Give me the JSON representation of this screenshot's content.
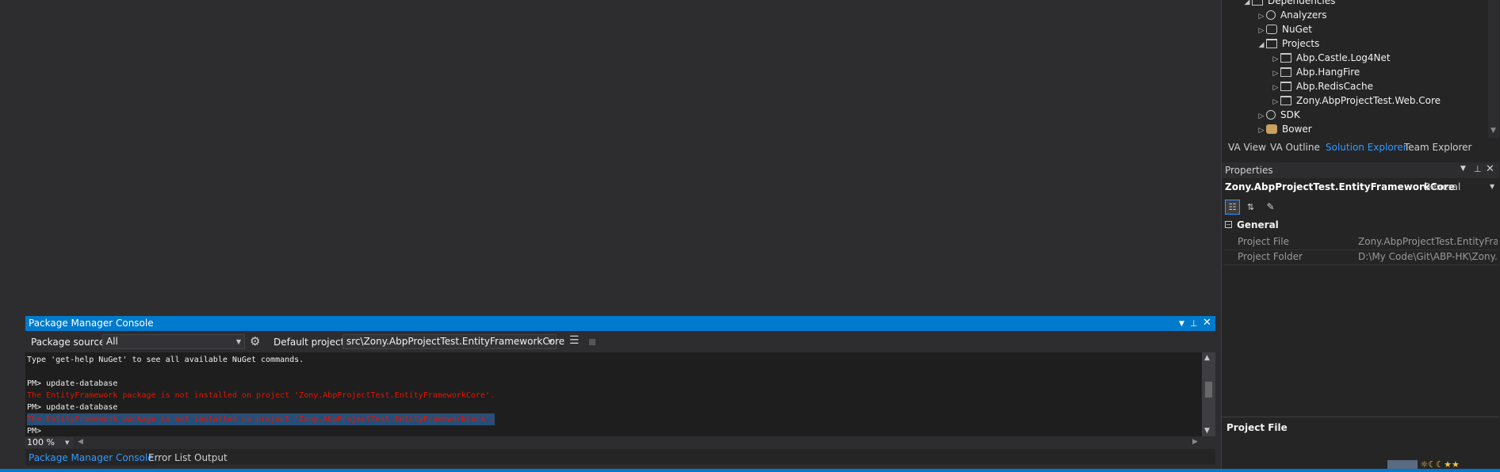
{
  "solution_tree": [
    {
      "label": "Dependencies",
      "indent": 1,
      "expanded": true,
      "icon": "dependencies-icon"
    },
    {
      "label": "Analyzers",
      "indent": 2,
      "expanded": false,
      "icon": "analyzer-icon"
    },
    {
      "label": "NuGet",
      "indent": 2,
      "expanded": false,
      "icon": "nuget-icon"
    },
    {
      "label": "Projects",
      "indent": 2,
      "expanded": true,
      "icon": "projects-icon"
    },
    {
      "label": "Abp.Castle.Log4Net",
      "indent": 3,
      "expanded": false,
      "icon": "project-icon"
    },
    {
      "label": "Abp.HangFire",
      "indent": 3,
      "expanded": false,
      "icon": "project-icon"
    },
    {
      "label": "Abp.RedisCache",
      "indent": 3,
      "expanded": false,
      "icon": "project-icon"
    },
    {
      "label": "Zony.AbpProjectTest.Web.Core",
      "indent": 3,
      "expanded": false,
      "icon": "project-icon"
    },
    {
      "label": "SDK",
      "indent": 2,
      "expanded": false,
      "icon": "sdk-icon"
    },
    {
      "label": "Bower",
      "indent": 2,
      "expanded": false,
      "icon": "bower-icon"
    }
  ],
  "right_tabs": [
    {
      "label": "VA View",
      "active": false
    },
    {
      "label": "VA Outline",
      "active": false
    },
    {
      "label": "Solution Explorer",
      "active": true
    },
    {
      "label": "Team Explorer",
      "active": false
    }
  ],
  "properties": {
    "title": "Properties",
    "object_name": "Zony.AbpProjectTest.EntityFrameworkCore",
    "object_type": "General",
    "category": "General",
    "rows": [
      {
        "name": "Project File",
        "value": "Zony.AbpProjectTest.EntityFrame"
      },
      {
        "name": "Project Folder",
        "value": "D:\\My Code\\Git\\ABP-HK\\Zony.A"
      }
    ],
    "description_title": "Project File"
  },
  "pmc": {
    "title": "Package Manager Console",
    "package_source_label": "Package source:",
    "package_source_value": "All",
    "default_project_label": "Default project:",
    "default_project_value": "src\\Zony.AbpProjectTest.EntityFrameworkCore",
    "zoom": "100 %",
    "lines": [
      {
        "text": "Type 'get-help NuGet' to see all available NuGet commands.",
        "kind": "normal"
      },
      {
        "text": "",
        "kind": "normal"
      },
      {
        "text": "PM> update-database",
        "kind": "normal"
      },
      {
        "text": "The EntityFramework package is not installed on project 'Zony.AbpProjectTest.EntityFrameworkCore'.",
        "kind": "error"
      },
      {
        "text": "PM> update-database",
        "kind": "normal"
      },
      {
        "text": "The EntityFramework package is not installed on project 'Zony.AbpProjectTest.EntityFrameworkCore'.",
        "kind": "selected"
      },
      {
        "text": "PM>",
        "kind": "normal"
      }
    ]
  },
  "bottom_tabs": [
    {
      "label": "Package Manager Console",
      "active": true
    },
    {
      "label": "Error List",
      "active": false
    },
    {
      "label": "Output",
      "active": false
    }
  ],
  "colors": {
    "accent": "#007acc",
    "error": "#e51400",
    "active_tab": "#3399ff"
  }
}
